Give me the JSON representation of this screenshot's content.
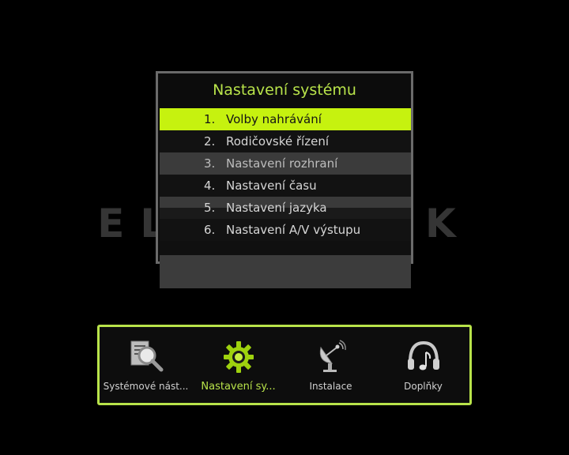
{
  "panel": {
    "title": "Nastavení systému",
    "items": [
      {
        "num": "1.",
        "label": "Volby nahrávání"
      },
      {
        "num": "2.",
        "label": "Rodičovské řízení"
      },
      {
        "num": "3.",
        "label": "Nastavení rozhraní"
      },
      {
        "num": "4.",
        "label": "Nastavení času"
      },
      {
        "num": "5.",
        "label": "Nastavení jazyka"
      },
      {
        "num": "6.",
        "label": "Nastavení A/V výstupu"
      }
    ]
  },
  "watermark": "ELLINO.SK",
  "bottom_menu": {
    "items": [
      {
        "label": "Systémové nást...",
        "icon": "magnifier-document-icon"
      },
      {
        "label": "Nastavení sy...",
        "icon": "gear-icon"
      },
      {
        "label": "Instalace",
        "icon": "satellite-dish-icon"
      },
      {
        "label": "Doplňky",
        "icon": "headphones-music-icon"
      }
    ]
  },
  "colors": {
    "accent": "#b8e34a",
    "selected": "#c6f20f",
    "background": "#000000"
  }
}
